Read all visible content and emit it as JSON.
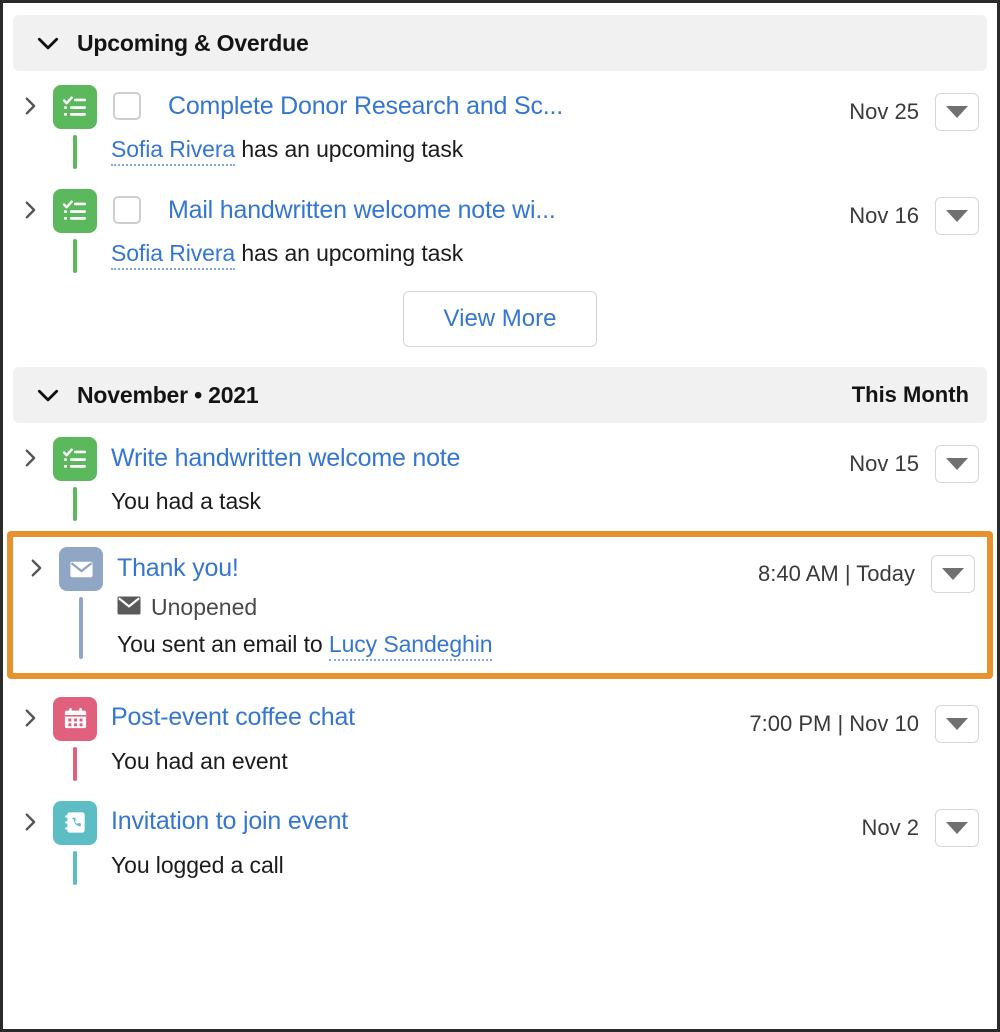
{
  "colors": {
    "link": "#3576d3",
    "highlight": "#e8922e",
    "task_icon_bg": "#5cb85c",
    "task_thread": "#5cb85c",
    "email_icon_bg": "#8fa7c4",
    "email_thread": "#8fa7c4",
    "event_icon_bg": "#e0607e",
    "event_thread": "#e0607e",
    "call_icon_bg": "#5cbec4",
    "call_thread": "#5cbec4",
    "header_bg": "#f1f1f1"
  },
  "sections": [
    {
      "id": "upcoming-overdue",
      "title": "Upcoming & Overdue",
      "right_label": "",
      "collapse_icon": "chevron-down-icon",
      "rows": [
        {
          "id": "complete-donor-research",
          "icon": "task-checklist-icon",
          "icon_kind": "task",
          "has_checkbox": true,
          "checkbox_checked": false,
          "title": "Complete Donor Research and Sc...",
          "date": "Nov 25",
          "sub_prefix": "",
          "sub_link": "Sofia Rivera",
          "sub_suffix": " has an upcoming task",
          "status": null,
          "caret_icon": "caret-down-icon"
        },
        {
          "id": "mail-handwritten-welcome-note",
          "icon": "task-checklist-icon",
          "icon_kind": "task",
          "has_checkbox": true,
          "checkbox_checked": false,
          "title": "Mail handwritten welcome note wi...",
          "date": "Nov 16",
          "sub_prefix": "",
          "sub_link": "Sofia Rivera",
          "sub_suffix": " has an upcoming task",
          "status": null,
          "caret_icon": "caret-down-icon"
        }
      ],
      "view_more_label": "View More"
    },
    {
      "id": "november-2021",
      "title": "November • 2021",
      "right_label": "This Month",
      "collapse_icon": "chevron-down-icon",
      "rows": [
        {
          "id": "write-handwritten-welcome-note",
          "icon": "task-checklist-icon",
          "icon_kind": "task",
          "has_checkbox": false,
          "title": "Write handwritten welcome note",
          "date": "Nov 15",
          "sub_prefix": "You had a task",
          "sub_link": null,
          "sub_suffix": "",
          "status": null,
          "caret_icon": "caret-down-icon"
        },
        {
          "id": "thank-you-email",
          "icon": "email-envelope-icon",
          "icon_kind": "email",
          "has_checkbox": false,
          "highlighted": true,
          "title": "Thank you!",
          "date": "8:40 AM | Today",
          "status": "Unopened",
          "status_icon": "envelope-icon",
          "sub_prefix": "You sent an email to ",
          "sub_link": "Lucy Sandeghin",
          "sub_suffix": "",
          "caret_icon": "caret-down-icon"
        },
        {
          "id": "post-event-coffee-chat",
          "icon": "calendar-icon",
          "icon_kind": "event",
          "has_checkbox": false,
          "title": "Post-event coffee chat",
          "date": "7:00 PM | Nov 10",
          "sub_prefix": "You had an event",
          "sub_link": null,
          "sub_suffix": "",
          "status": null,
          "caret_icon": "caret-down-icon"
        },
        {
          "id": "invitation-to-join-event",
          "icon": "phone-log-icon",
          "icon_kind": "call",
          "has_checkbox": false,
          "title": "Invitation to join event",
          "date": "Nov 2",
          "sub_prefix": "You logged a call",
          "sub_link": null,
          "sub_suffix": "",
          "status": null,
          "caret_icon": "caret-down-icon"
        }
      ],
      "view_more_label": null
    }
  ]
}
